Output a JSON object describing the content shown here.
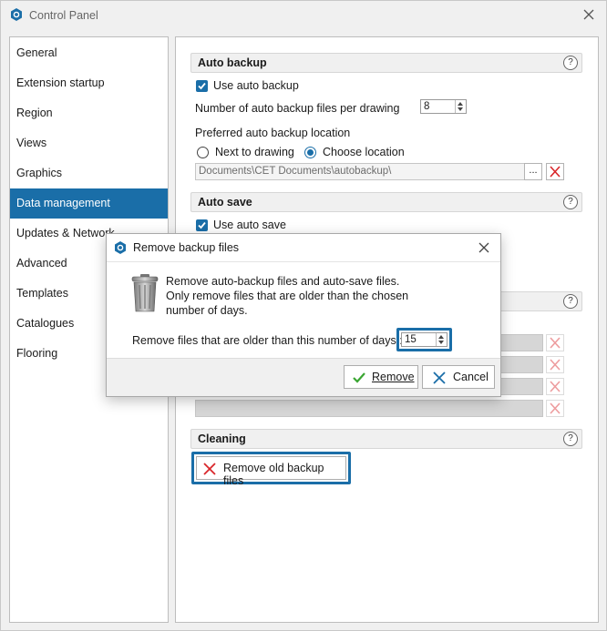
{
  "window": {
    "title": "Control Panel"
  },
  "sidebar": {
    "items": [
      {
        "label": "General"
      },
      {
        "label": "Extension startup"
      },
      {
        "label": "Region"
      },
      {
        "label": "Views"
      },
      {
        "label": "Graphics"
      },
      {
        "label": "Data management",
        "selected": true
      },
      {
        "label": "Updates & Network"
      },
      {
        "label": "Advanced"
      },
      {
        "label": "Templates"
      },
      {
        "label": "Catalogues"
      },
      {
        "label": "Flooring"
      }
    ]
  },
  "auto_backup": {
    "header": "Auto backup",
    "help": "?",
    "use_label": "Use auto backup",
    "use_checked": true,
    "files_label": "Number of auto backup files per drawing",
    "files_value": "8",
    "location_label": "Preferred auto backup location",
    "option_next": "Next to drawing",
    "option_choose": "Choose location",
    "selected_option": "Choose location",
    "path": "Documents\\CET Documents\\autobackup\\",
    "browse": "..."
  },
  "auto_save": {
    "header": "Auto save",
    "help": "?",
    "use_label": "Use auto save",
    "use_checked": true
  },
  "hidden_group": {
    "help": "?"
  },
  "cleaning": {
    "header": "Cleaning",
    "help": "?",
    "remove_button": "Remove old backup files"
  },
  "dialog": {
    "title": "Remove backup files",
    "message_line1": "Remove auto-backup files and auto-save files.",
    "message_line2": "Only remove files that are older than the chosen",
    "message_line3": "number of days.",
    "days_label": "Remove files that are older than this number of days :",
    "days_value": "15",
    "remove_button": "Remove",
    "cancel_button": "Cancel"
  },
  "colors": {
    "accent": "#1a6ea8",
    "delete_red": "#d9262a",
    "ok_green": "#3aa632"
  }
}
